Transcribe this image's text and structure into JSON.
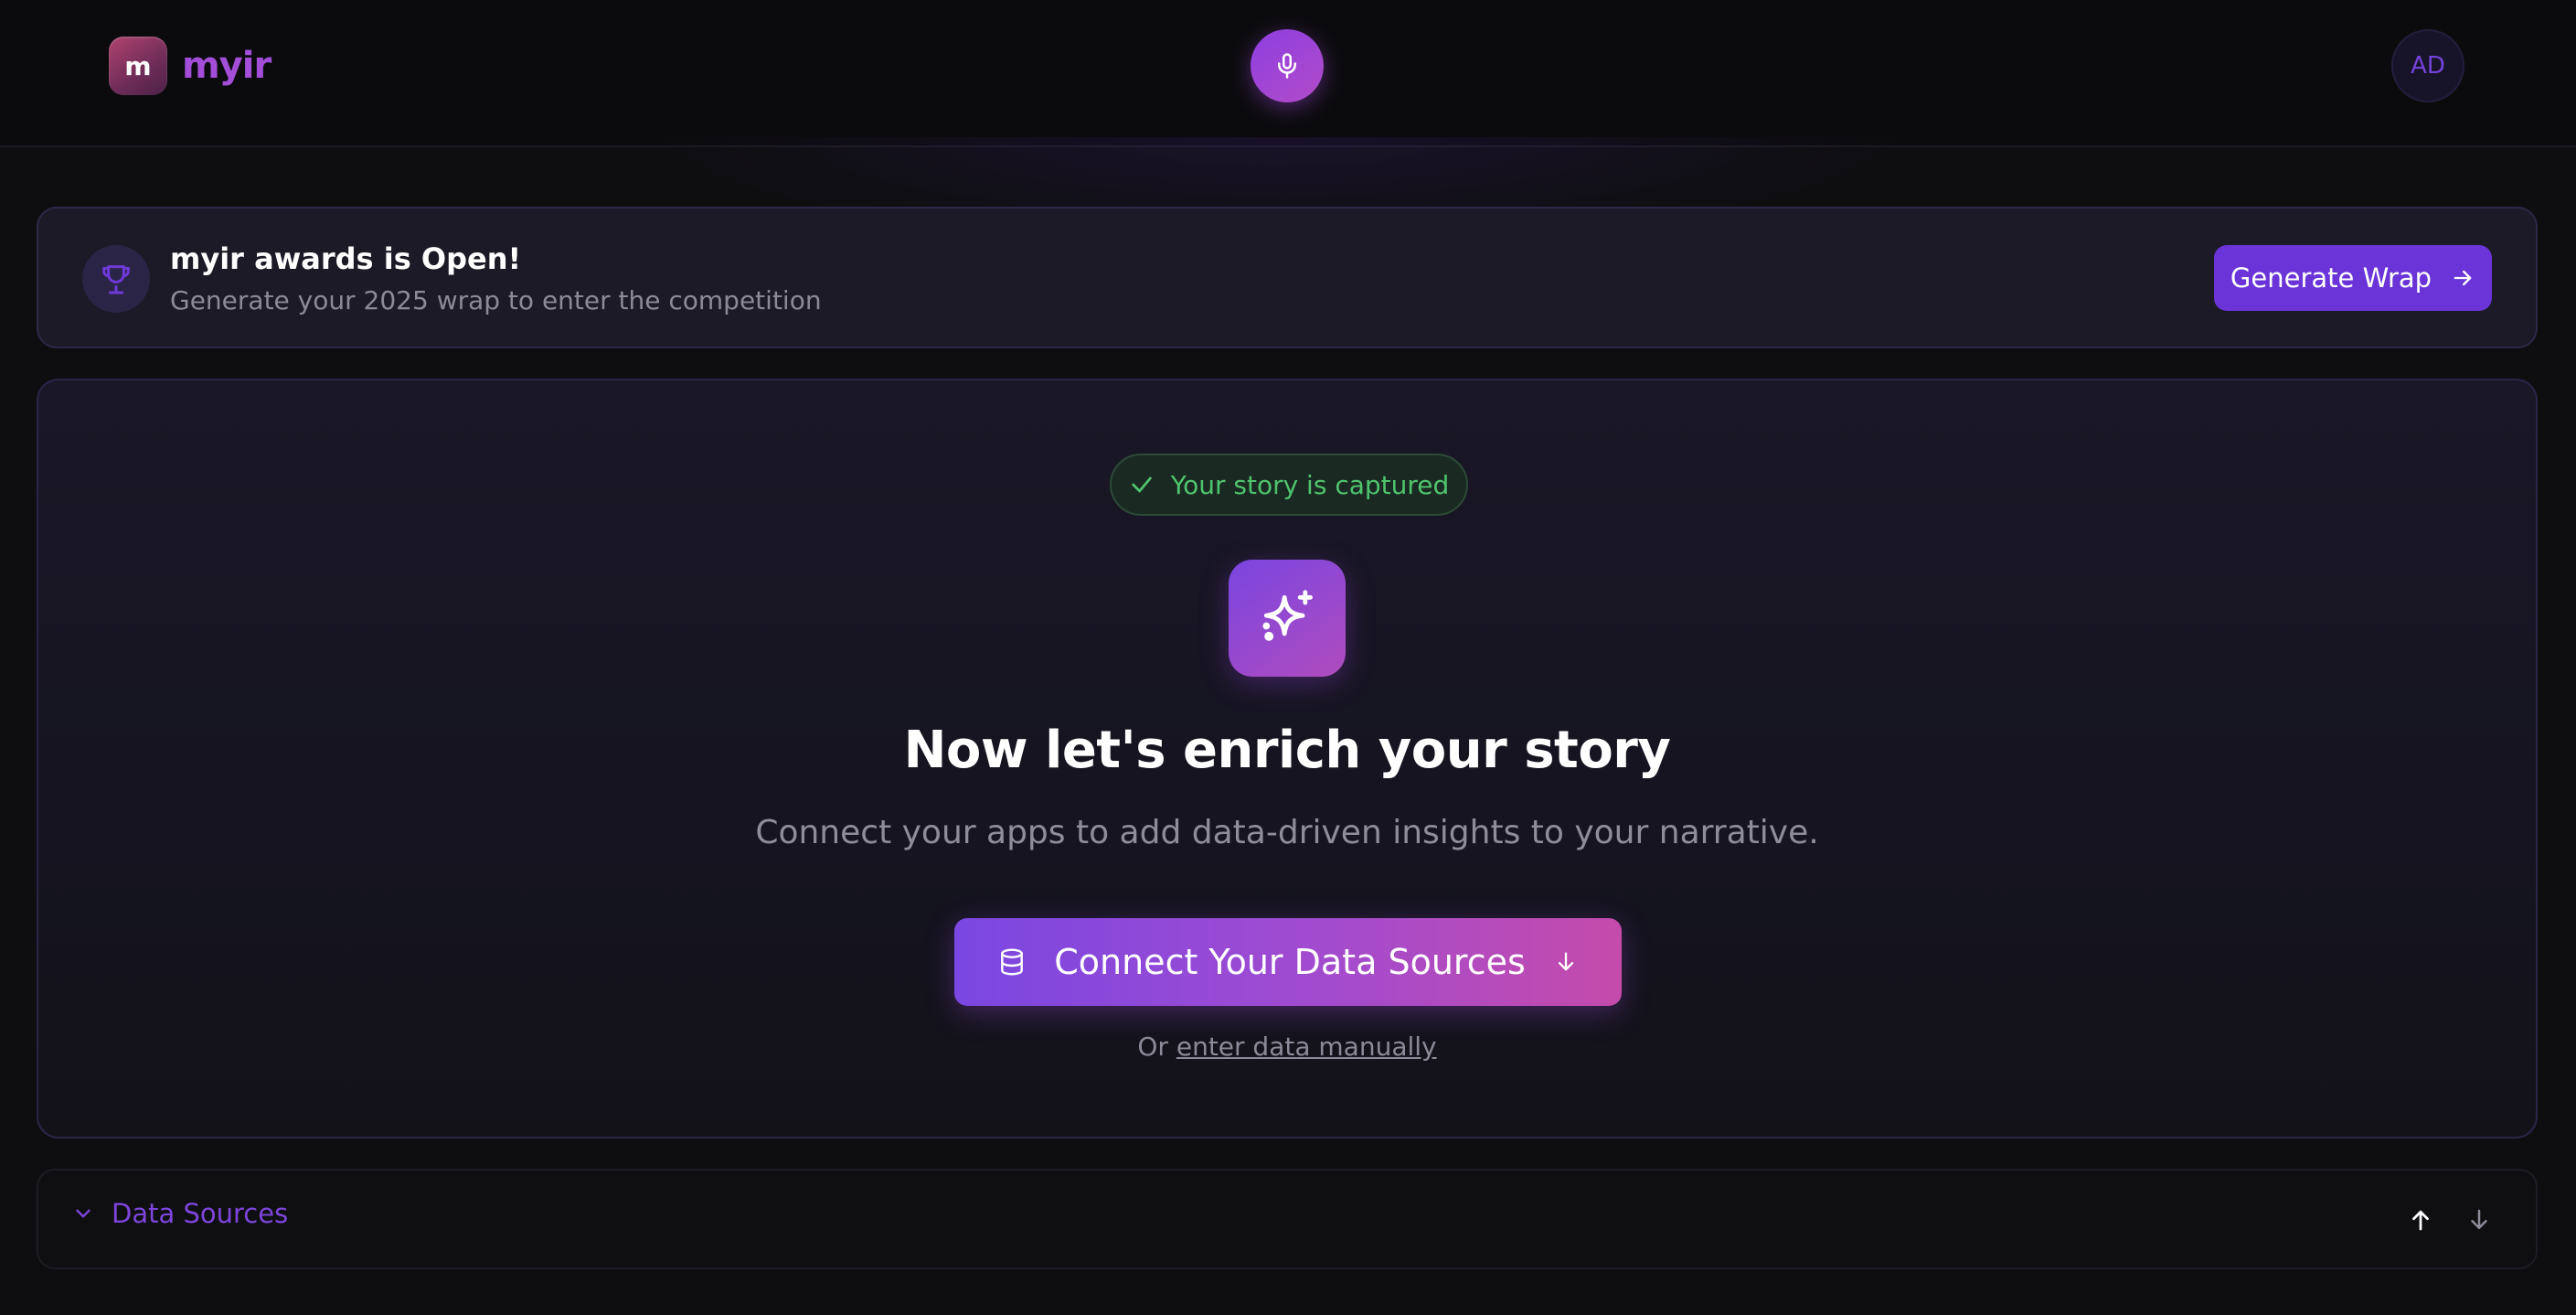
{
  "header": {
    "logo_letter": "m",
    "brand_name": "myir",
    "mic_icon": "microphone-icon",
    "avatar_initials": "AD"
  },
  "awards": {
    "icon": "trophy-icon",
    "title": "myir awards is Open!",
    "subtitle": "Generate your 2025 wrap to enter the competition",
    "button_label": "Generate Wrap",
    "button_icon": "arrow-right-icon"
  },
  "story": {
    "status_badge": "Your story is captured",
    "status_icon": "check-icon",
    "hero_icon": "sparkles-icon",
    "title": "Now let's enrich your story",
    "subtitle": "Connect your apps to add data-driven insights to your narrative.",
    "connect_button": "Connect Your Data Sources",
    "connect_icon": "database-icon",
    "connect_arrow_icon": "arrow-down-icon",
    "manual_prefix": "Or",
    "manual_link": "enter data manually"
  },
  "sources": {
    "label": "Data Sources",
    "toggle_icon": "chevron-down-icon",
    "move_up_icon": "arrow-up-icon",
    "move_down_icon": "arrow-down-icon"
  },
  "colors": {
    "background": "#0e0e10",
    "brand_purple": "#a24ed8",
    "accent": "#6b34d8",
    "success": "#4fc36e",
    "muted_text": "#8c8a98"
  }
}
